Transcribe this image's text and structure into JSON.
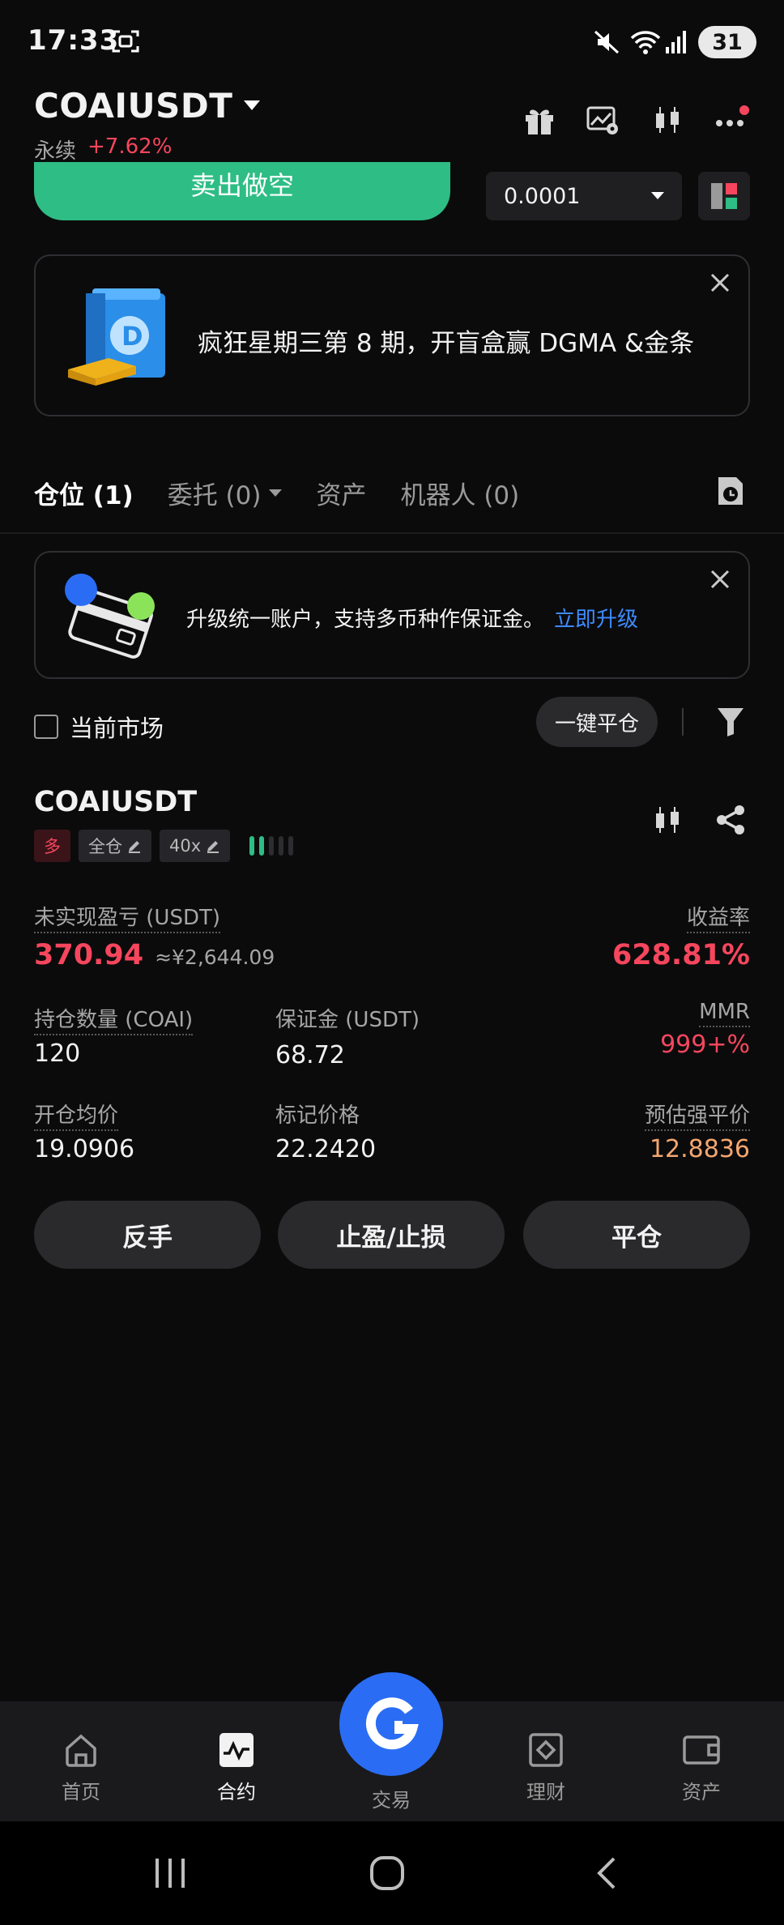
{
  "status_bar": {
    "time": "17:33",
    "battery": "31"
  },
  "header": {
    "pair": "COAIUSDT",
    "contract_type": "永续",
    "change": "+7.62%"
  },
  "order_panel": {
    "sell_label": "卖出做空",
    "quantity_step": "0.0001"
  },
  "promo": {
    "text": "疯狂星期三第 8 期，开盲盒赢 DGMA &金条"
  },
  "tabs": [
    {
      "label": "仓位 (1)"
    },
    {
      "label": "委托 (0)"
    },
    {
      "label": "资产"
    },
    {
      "label": "机器人 (0)"
    }
  ],
  "upgrade_banner": {
    "text": "升级统一账户，支持多币种作保证金。",
    "link": "立即升级"
  },
  "filters": {
    "current_market": "当前市场",
    "close_all": "一键平仓"
  },
  "position": {
    "symbol": "COAIUSDT",
    "side": "多",
    "margin_mode": "全仓",
    "leverage": "40x",
    "unrealized_pnl_label": "未实现盈亏 (USDT)",
    "unrealized_pnl": "370.94",
    "unrealized_pnl_cny": "≈¥2,644.09",
    "roe_label": "收益率",
    "roe": "628.81%",
    "size_label": "持仓数量 (COAI)",
    "size": "120",
    "margin_label": "保证金 (USDT)",
    "margin": "68.72",
    "mmr_label": "MMR",
    "mmr": "999+%",
    "entry_label": "开仓均价",
    "entry": "19.0906",
    "mark_label": "标记价格",
    "mark": "22.2420",
    "liq_label": "预估强平价",
    "liq": "12.8836"
  },
  "actions": {
    "reverse": "反手",
    "tpsl": "止盈/止损",
    "close": "平仓"
  },
  "nav": {
    "home": "首页",
    "futures": "合约",
    "trade": "交易",
    "earn": "理财",
    "assets": "资产"
  }
}
